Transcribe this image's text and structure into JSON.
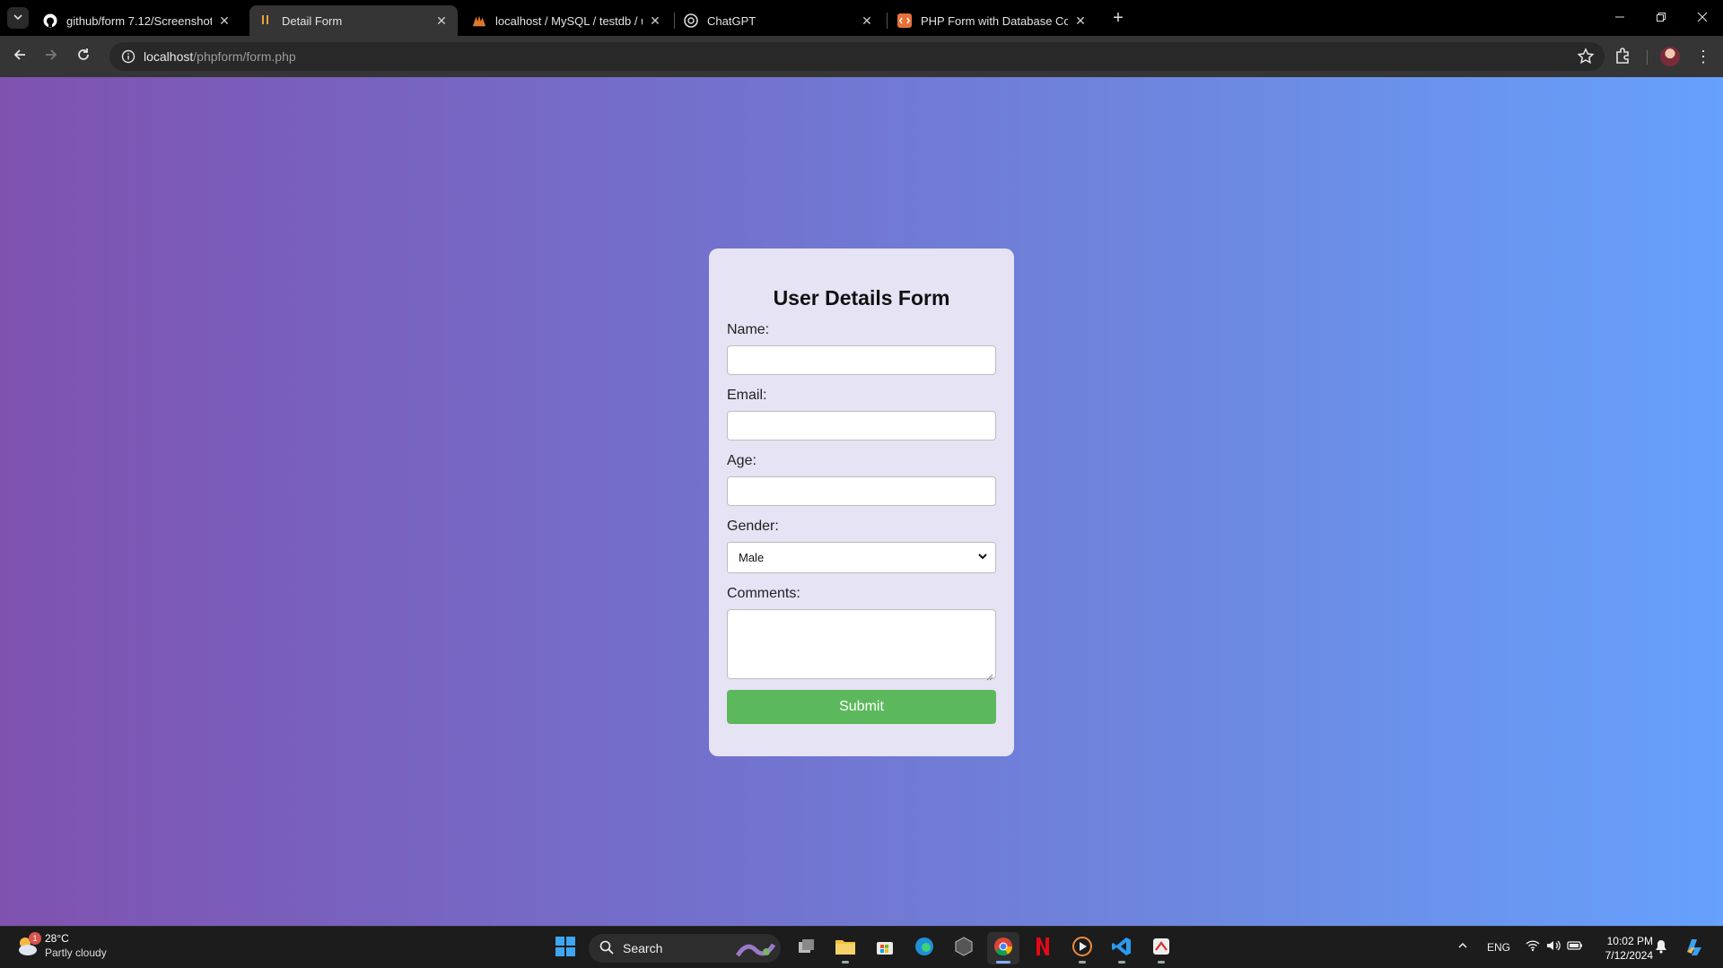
{
  "browser": {
    "tabs": [
      {
        "title": "github/form 7.12/Screenshot 20",
        "favicon": "github-icon",
        "active": false
      },
      {
        "title": "Detail Form",
        "favicon": "page-icon",
        "active": true
      },
      {
        "title": "localhost / MySQL / testdb / us",
        "favicon": "phpmyadmin-icon",
        "active": false
      },
      {
        "title": "ChatGPT",
        "favicon": "chatgpt-icon",
        "active": false
      },
      {
        "title": "PHP Form with Database Conne",
        "favicon": "code-icon",
        "active": false
      }
    ],
    "url_host": "localhost",
    "url_path": "/phpform/form.php"
  },
  "form": {
    "title": "User Details Form",
    "name_label": "Name:",
    "name_value": "",
    "email_label": "Email:",
    "email_value": "",
    "age_label": "Age:",
    "age_value": "",
    "gender_label": "Gender:",
    "gender_selected": "Male",
    "comments_label": "Comments:",
    "comments_value": "",
    "submit_label": "Submit"
  },
  "taskbar": {
    "weather_temp": "28°C",
    "weather_condition": "Partly cloudy",
    "weather_badge": "1",
    "search_placeholder": "Search",
    "language": "ENG",
    "time": "10:02 PM",
    "date": "7/12/2024"
  },
  "colors": {
    "gradient_start": "#7f52b0",
    "gradient_end": "#66a1fd",
    "card_bg": "#e6e3f5",
    "submit_bg": "#5cb85c"
  }
}
